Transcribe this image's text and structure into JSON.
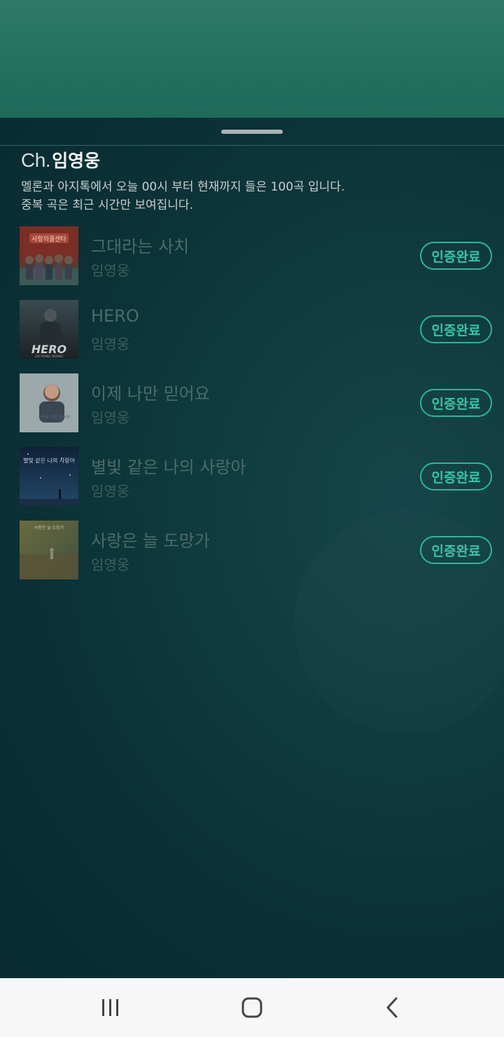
{
  "header": {
    "channel_prefix": "Ch.",
    "channel_name": "임영웅"
  },
  "description": {
    "line1": "멜론과 아지톡에서 오늘 00시 부터 현재까지 들은 100곡 입니다.",
    "line2": "중복 곡은 최근 시간만 보여집니다."
  },
  "songs": [
    {
      "title": "그대라는 사치",
      "artist": "임영웅",
      "status": "인증완료",
      "cover_text": "사랑의콜센타"
    },
    {
      "title": "HERO",
      "artist": "임영웅",
      "status": "인증완료",
      "cover_text": "HERO",
      "cover_subtext": "LIM YOUNG WOONG"
    },
    {
      "title": "이제 나만 믿어요",
      "artist": "임영웅",
      "status": "인증완료",
      "cover_text": "이제 나만 믿어요"
    },
    {
      "title": "별빛 같은 나의 사랑아",
      "artist": "임영웅",
      "status": "인증완료",
      "cover_text": "별빛 같은 나의 사랑아"
    },
    {
      "title": "사랑은 늘 도망가",
      "artist": "임영웅",
      "status": "인증완료",
      "cover_text": "사랑은 늘 도망가"
    }
  ],
  "colors": {
    "accent": "#2bb79a",
    "sheet_bg": "#0b3136",
    "top_bg": "#2e7a66",
    "navbar_bg": "#f7f7f7"
  },
  "navbar": {
    "icons": [
      "recent-apps-icon",
      "home-icon",
      "back-icon"
    ]
  }
}
